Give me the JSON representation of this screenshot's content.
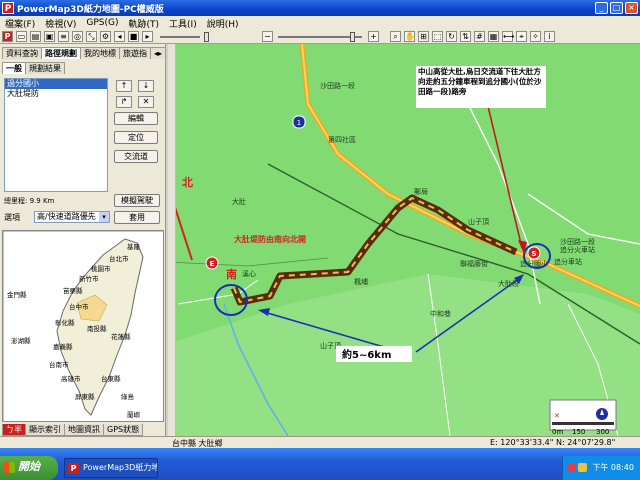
{
  "window": {
    "title": "PowerMap3D紙力地圖-PC權威版",
    "app_icon": "P"
  },
  "menu": [
    "檔案(F)",
    "檢視(V)",
    "GPS(G)",
    "軌跡(T)",
    "工具(I)",
    "說明(H)"
  ],
  "left_panel": {
    "top_tabs": [
      "資料查詢",
      "路徑規劃",
      "我的地標",
      "旅遊指"
    ],
    "sub_tabs": [
      "一般",
      "規劃結果"
    ],
    "route_list": [
      {
        "label": "過分國小",
        "selected": true
      },
      {
        "label": "大肚堤防",
        "selected": false
      }
    ],
    "buttons": {
      "edit": "編輯",
      "locate": "定位",
      "interchange": "交流道",
      "simulate": "模擬駕駛",
      "apply": "套用"
    },
    "route_info_left": "總里程: 9.9 Km",
    "options_label": "選項",
    "option_value": "高/快速道路優先",
    "bottom_tabs": [
      "ㄅ半",
      "顯示索引",
      "地圖資訊",
      "GPS狀態"
    ]
  },
  "minimap": {
    "labels": [
      "基隆",
      "台北市",
      "桃園市",
      "新竹市",
      "苗栗縣",
      "台中市",
      "彰化縣",
      "南投縣",
      "花蓮縣",
      "嘉義縣",
      "台南市",
      "高雄市",
      "台東縣",
      "屏東縣",
      "綠島",
      "金門縣",
      "澎湖縣",
      "蘭嶼"
    ]
  },
  "map": {
    "annotation_top": "中山高從大肚,烏日交流道下往大肚方向走約五分鐘車程到追分國小(位於沙田路一段)路旁",
    "north_label": "北",
    "south_label": "南",
    "embankment_label": "大肚堤防由南向北開",
    "distance_label": "約5~6km",
    "start_marker": "S",
    "end_marker": "E",
    "highway_shield": "1",
    "places": [
      "沙田路一段",
      "第四社區",
      "郵局",
      "山子頂",
      "追分國小",
      "追分火車站",
      "追分車站",
      "聯福藤街",
      "中和巷",
      "山子頂",
      "楓埔",
      "大肚",
      "溪心",
      "沙田路一段",
      "大肚段"
    ],
    "scale_labels": [
      "0m",
      "150",
      "300"
    ]
  },
  "status_bar": {
    "location": "台中縣 大肚鄉",
    "coords": "E: 120°33'33.4\" N: 24°07'29.8\""
  },
  "taskbar": {
    "start_label": "開始",
    "task_item": "PowerMap3D紙力地...",
    "clock": "下午 08:40"
  }
}
